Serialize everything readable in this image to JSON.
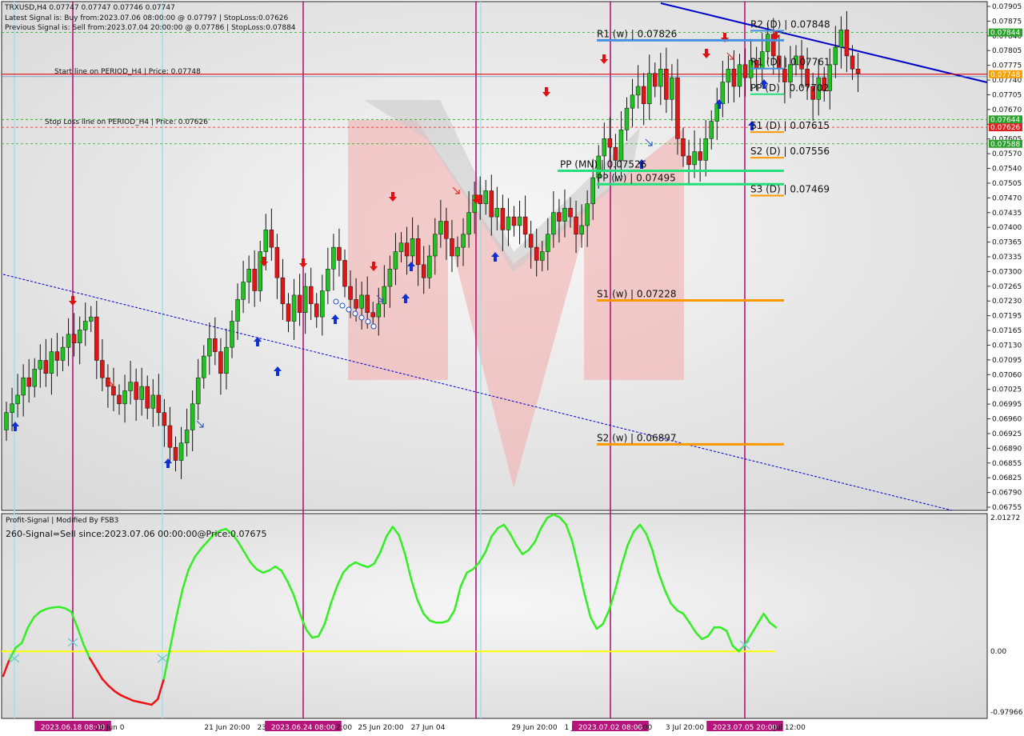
{
  "header": {
    "symbol_line": "TRXUSD,H4  0.07747 0.07747 0.07746 0.07747",
    "latest_signal": "Latest Signal is: Buy from:2023.07.06 08:00:00 @ 0.07797 | StopLoss:0.07626",
    "previous_signal": "Previous Signal is: Sell from:2023.07.04 20:00:00 @ 0.07786 | StopLoss:0.07884"
  },
  "annotations": {
    "start_line": "Start line on PERIOD_H4 | Price: 0.07748",
    "stop_loss_line": "Stop Loss line on PERIOD_H4 | Price: 0.07626"
  },
  "indicator": {
    "title": "Profit-Signal | Modified By FSB3",
    "signal": "260-Signal=Sell since:2023.07.06 00:00:00@Price:0.07675"
  },
  "chart_data": [
    {
      "type": "candlestick",
      "symbol": "TRXUSD",
      "timeframe": "H4",
      "ylim": [
        0.06745,
        0.07915
      ],
      "y_tick_labels": [
        "0.07905",
        "0.07875",
        "0.07840",
        "0.07805",
        "0.07775",
        "0.07740",
        "0.07705",
        "0.07670",
        "0.07640",
        "0.07605",
        "0.07570",
        "0.07540",
        "0.07505",
        "0.07470",
        "0.07435",
        "0.07400",
        "0.07365",
        "0.07335",
        "0.07300",
        "0.07265",
        "0.07230",
        "0.07195",
        "0.07165",
        "0.07130",
        "0.07095",
        "0.07060",
        "0.07025",
        "0.06995",
        "0.06960",
        "0.06925",
        "0.06890",
        "0.06855",
        "0.06825",
        "0.06790",
        "0.06755"
      ],
      "close_series": [
        0.0697,
        0.0699,
        0.0701,
        0.0705,
        0.0703,
        0.0707,
        0.0709,
        0.0706,
        0.0711,
        0.0709,
        0.0712,
        0.0715,
        0.0713,
        0.0716,
        0.0718,
        0.0719,
        0.0709,
        0.0705,
        0.0703,
        0.0701,
        0.0699,
        0.0702,
        0.0704,
        0.07,
        0.0703,
        0.0698,
        0.0701,
        0.0697,
        0.0694,
        0.0689,
        0.0686,
        0.069,
        0.0693,
        0.0699,
        0.0705,
        0.071,
        0.0714,
        0.0711,
        0.0706,
        0.0712,
        0.0718,
        0.0723,
        0.0727,
        0.073,
        0.0725,
        0.0734,
        0.0739,
        0.0735,
        0.0728,
        0.0722,
        0.0718,
        0.0724,
        0.072,
        0.0726,
        0.0722,
        0.0719,
        0.0725,
        0.073,
        0.0735,
        0.0732,
        0.0726,
        0.0723,
        0.0721,
        0.0724,
        0.072,
        0.0719,
        0.0722,
        0.0726,
        0.073,
        0.0734,
        0.0736,
        0.0733,
        0.0737,
        0.0731,
        0.0728,
        0.0733,
        0.0738,
        0.0741,
        0.0737,
        0.0733,
        0.0735,
        0.0738,
        0.0743,
        0.0747,
        0.0745,
        0.0748,
        0.0742,
        0.0744,
        0.0739,
        0.0742,
        0.074,
        0.0742,
        0.0738,
        0.0735,
        0.0732,
        0.0734,
        0.0738,
        0.0743,
        0.0741,
        0.0744,
        0.0742,
        0.0738,
        0.074,
        0.0745,
        0.0751,
        0.0756,
        0.076,
        0.0758,
        0.0755,
        0.0762,
        0.0767,
        0.077,
        0.0772,
        0.0768,
        0.0775,
        0.0772,
        0.0776,
        0.0769,
        0.0774,
        0.076,
        0.0756,
        0.0754,
        0.0757,
        0.0755,
        0.076,
        0.0764,
        0.0768,
        0.0773,
        0.0776,
        0.0772,
        0.0777,
        0.0774,
        0.0778,
        0.0776,
        0.078,
        0.0784,
        0.0779,
        0.0776,
        0.0773,
        0.0777,
        0.0779,
        0.0776,
        0.0772,
        0.0769,
        0.0774,
        0.0771,
        0.0777,
        0.0781,
        0.0785,
        0.0779,
        0.0776,
        0.0775
      ],
      "price_levels": [
        {
          "label": "R2 (D) | 0.07848",
          "value": 0.07848
        },
        {
          "label": "R1 (w) | 0.07826",
          "value": 0.07826
        },
        {
          "label": "R1 (D) | 0.07761",
          "value": 0.07761
        },
        {
          "label": "PP (D) | 0.07702",
          "value": 0.07702
        },
        {
          "label": "S1 (D) | 0.07615",
          "value": 0.07615
        },
        {
          "label": "S2 (D) | 0.07556",
          "value": 0.07556
        },
        {
          "label": "PP (MN) | 0.07526",
          "value": 0.07526
        },
        {
          "label": "PP (w) | 0.07495",
          "value": 0.07495
        },
        {
          "label": "S3 (D) | 0.07469",
          "value": 0.07469
        },
        {
          "label": "S1 (w) | 0.07228",
          "value": 0.07228
        },
        {
          "label": "S2 (w) | 0.06897",
          "value": 0.06897
        }
      ],
      "price_tags": [
        {
          "label": "0.07844",
          "value": 0.07844,
          "color": "#2ca02c"
        },
        {
          "label": "0.07748",
          "value": 0.07748,
          "color": "#f5a000"
        },
        {
          "label": "0.07644",
          "value": 0.07644,
          "color": "#2ca02c"
        },
        {
          "label": "0.07626",
          "value": 0.07626,
          "color": "#dd2222"
        },
        {
          "label": "0.07588",
          "value": 0.07588,
          "color": "#2ca02c"
        }
      ]
    },
    {
      "type": "line",
      "ylim": [
        -0.97966,
        2.01272
      ],
      "y_tick_labels": [
        "2.01272",
        "0.00",
        "-0.97966"
      ],
      "zero_line": 0.0,
      "values": [
        -0.36,
        -0.12,
        0.05,
        0.12,
        0.35,
        0.5,
        0.58,
        0.62,
        0.64,
        0.65,
        0.63,
        0.58,
        0.35,
        0.1,
        -0.1,
        -0.25,
        -0.4,
        -0.5,
        -0.58,
        -0.64,
        -0.68,
        -0.72,
        -0.74,
        -0.76,
        -0.78,
        -0.7,
        -0.4,
        0.05,
        0.5,
        0.9,
        1.2,
        1.38,
        1.5,
        1.6,
        1.7,
        1.76,
        1.79,
        1.72,
        1.6,
        1.45,
        1.3,
        1.2,
        1.15,
        1.18,
        1.24,
        1.18,
        1.02,
        0.82,
        0.55,
        0.32,
        0.2,
        0.22,
        0.4,
        0.7,
        0.95,
        1.15,
        1.25,
        1.3,
        1.26,
        1.23,
        1.28,
        1.45,
        1.68,
        1.82,
        1.7,
        1.42,
        1.05,
        0.75,
        0.55,
        0.45,
        0.42,
        0.42,
        0.45,
        0.6,
        0.95,
        1.15,
        1.2,
        1.3,
        1.45,
        1.68,
        1.8,
        1.85,
        1.72,
        1.55,
        1.42,
        1.48,
        1.6,
        1.8,
        1.95,
        2.0,
        1.96,
        1.86,
        1.62,
        1.25,
        0.85,
        0.5,
        0.33,
        0.4,
        0.6,
        0.9,
        1.25,
        1.55,
        1.75,
        1.85,
        1.72,
        1.48,
        1.15,
        0.9,
        0.7,
        0.6,
        0.55,
        0.42,
        0.28,
        0.18,
        0.22,
        0.35,
        0.35,
        0.3,
        0.08,
        0.0,
        0.1,
        0.25,
        0.4,
        0.55,
        0.42,
        0.35
      ]
    }
  ],
  "x_axis": {
    "labels": [
      "2023.06.18 08:00",
      "19 Jun 0",
      "21 Jun 20:00",
      "23 J",
      "2023.06.24 08:00",
      "2:00",
      "25 Jun 20:00",
      "27 Jun 04",
      "29 Jun 20:00",
      "1 Ju",
      "2023.07.02 08:00",
      ":00",
      "3 Jul 20:00",
      "2023.07.05 20:00",
      "Jul 12:00"
    ]
  },
  "colors": {
    "panel_background": "#d9d9d9",
    "bull_candle": "#1fc21f",
    "bear_candle": "#e01515",
    "oscillator_up": "#33ee22",
    "oscillator_down": "#ee1111",
    "zero_line": "#ffff00",
    "vertical_markers": "#b5147a",
    "vertical_markers_light": "#9ae0ea",
    "resistance_line": "#4a90e0",
    "pivot_line": "#22e07a",
    "support_line": "#ff9900",
    "trendline": "#0000cc"
  },
  "icons": [
    "buy-arrow-icon",
    "sell-arrow-icon",
    "hollow-arrow-icon"
  ]
}
